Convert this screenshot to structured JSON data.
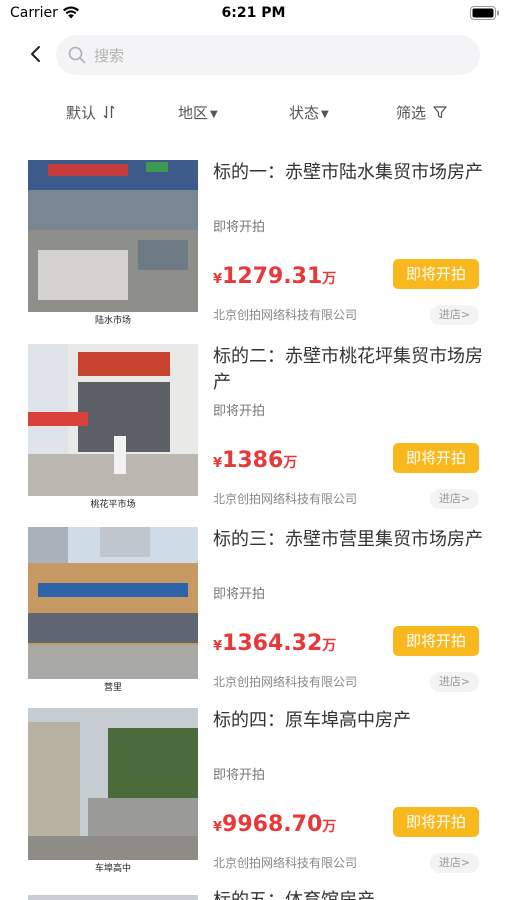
{
  "status_bar": {
    "carrier": "Carrier",
    "time": "6:21 PM"
  },
  "search": {
    "placeholder": "搜索"
  },
  "filters": [
    {
      "label": "默认",
      "icon": "sort-icon"
    },
    {
      "label": "地区",
      "icon": "caret-down-icon"
    },
    {
      "label": "状态",
      "icon": "caret-down-icon"
    },
    {
      "label": "筛选",
      "icon": "filter-funnel-icon"
    }
  ],
  "items": [
    {
      "title": "标的一：赤壁市陆水集贸市场房产",
      "status": "即将开拍",
      "currency": "¥",
      "price": "1279.31",
      "unit": "万",
      "button": "即将开拍",
      "company": "北京创拍网络科技有限公司",
      "enter": "进店>",
      "caption": "陆水市场",
      "sign_text": "",
      "colors": {
        "sky": "#9bb5c9",
        "building": "#3c5a8a",
        "ground": "#8e8f8a"
      }
    },
    {
      "title": "标的二：赤壁市桃花坪集贸市场房产",
      "status": "即将开拍",
      "currency": "¥",
      "price": "1386",
      "unit": "万",
      "button": "即将开拍",
      "company": "北京创拍网络科技有限公司",
      "enter": "进店>",
      "caption": "桃花平市场",
      "sign_text": "蒲圻桃花坪集贸市场",
      "colors": {
        "sky": "#dfe4ea",
        "building": "#e9e9e7",
        "ground": "#b9b7b0"
      }
    },
    {
      "title": "标的三：赤壁市营里集贸市场房产",
      "status": "即将开拍",
      "currency": "¥",
      "price": "1364.32",
      "unit": "万",
      "button": "即将开拍",
      "company": "北京创拍网络科技有限公司",
      "enter": "进店>",
      "caption": "营里",
      "sign_text": "",
      "colors": {
        "sky": "#cfdce8",
        "building": "#c69a62",
        "ground": "#a8a9a6"
      }
    },
    {
      "title": "标的四：原车埠高中房产",
      "status": "即将开拍",
      "currency": "¥",
      "price": "9968.70",
      "unit": "万",
      "button": "即将开拍",
      "company": "北京创拍网络科技有限公司",
      "enter": "进店>",
      "caption": "车埠高中",
      "sign_text": "赤壁市车埠高级中学",
      "colors": {
        "sky": "#c5cdd3",
        "building": "#b8b2a2",
        "ground": "#8d8c86"
      }
    }
  ],
  "partial_item": {
    "title": "标的五：体育馆房产"
  }
}
